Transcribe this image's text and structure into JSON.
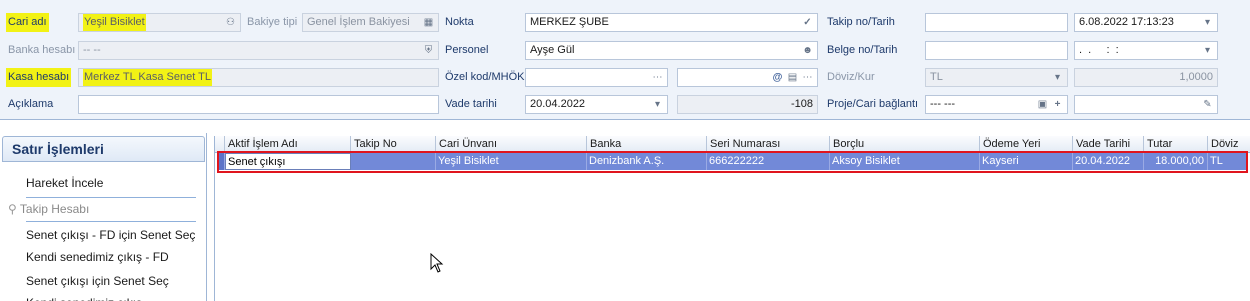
{
  "form": {
    "cari_adi": {
      "label": "Cari adı",
      "value": "Yeşil Bisiklet"
    },
    "bakiye_tipi": {
      "label": "Bakiye tipi",
      "value": "Genel İşlem Bakiyesi"
    },
    "banka_hesabi": {
      "label": "Banka hesabı",
      "value": "-- --"
    },
    "kasa_hesabi": {
      "label": "Kasa hesabı",
      "value": "Merkez TL Kasa Senet TL"
    },
    "aciklama": {
      "label": "Açıklama",
      "value": ""
    },
    "nokta": {
      "label": "Nokta",
      "value": "MERKEZ ŞUBE"
    },
    "personel": {
      "label": "Personel",
      "value": "Ayşe Gül"
    },
    "ozel_kod": {
      "label": "Özel kod/MHÖK",
      "value": "",
      "value2": ""
    },
    "vade_tarihi": {
      "label": "Vade tarihi",
      "value": "20.04.2022",
      "days": "-108"
    },
    "takip_no": {
      "label": "Takip no/Tarih",
      "value": "",
      "date": "6.08.2022 17:13:23"
    },
    "belge_no": {
      "label": "Belge no/Tarih",
      "value": "",
      "date": ".  .     :  :"
    },
    "doviz_kur": {
      "label": "Döviz/Kur",
      "currency": "TL",
      "rate": "1,0000"
    },
    "proje_cari": {
      "label": "Proje/Cari bağlantı",
      "value": "--- ---",
      "value2": ""
    }
  },
  "sidebar": {
    "title": "Satır İşlemleri",
    "items": [
      {
        "label": "Hareket İncele",
        "enabled": true
      },
      {
        "label": "Takip Hesabı",
        "enabled": false
      },
      {
        "label": "Senet çıkışı - FD için Senet Seç",
        "enabled": true
      },
      {
        "label": "Kendi senedimiz çıkış - FD",
        "enabled": true
      },
      {
        "label": "Senet çıkışı için Senet Seç",
        "enabled": true
      },
      {
        "label": "Kendi senedimiz çıkış",
        "enabled": true
      }
    ]
  },
  "grid": {
    "columns": [
      "Aktif İşlem Adı",
      "Takip No",
      "Cari Ünvanı",
      "Banka",
      "Seri Numarası",
      "Borçlu",
      "Ödeme Yeri",
      "Vade Tarihi",
      "Tutar",
      "Döviz"
    ],
    "rows": [
      [
        "Senet çıkışı",
        "",
        "Yeşil Bisiklet",
        "Denizbank A.Ş.",
        "666222222",
        "Aksoy Bisiklet",
        "Kayseri",
        "20.04.2022",
        "18.000,00",
        "TL"
      ]
    ]
  },
  "colors": {
    "highlight": "#f2f215",
    "selected_row": "#7289d8",
    "row_outline": "#e0151e",
    "label_text": "#1e3a6b"
  }
}
